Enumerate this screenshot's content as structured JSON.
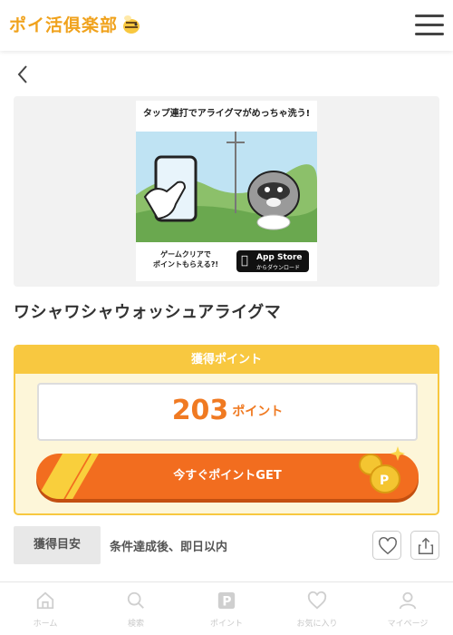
{
  "header": {
    "logo_text": "ポイ活俱楽部",
    "logo_icon": "bee-icon",
    "menu_icon": "hamburger-menu-icon"
  },
  "navigation": {
    "back_icon": "chevron-left-icon"
  },
  "banner": {
    "headline": "タップ連打でアライグマがめっちゃ洗う!",
    "cta_line1": "ゲームクリアで",
    "cta_line2": "ポイントもらえる?!",
    "store_name": "App Store",
    "store_sub": "からダウンロード"
  },
  "offer": {
    "title": "ワシャワシャウォッシュアライグマ",
    "panel_label": "獲得ポイント",
    "points": "203",
    "points_unit": "ポイント",
    "get_button_label": "今すぐポイントGET",
    "condition_label": "獲得目安",
    "condition_text": "条件達成後、即日以内"
  },
  "actions": {
    "favorite_icon": "heart-icon",
    "share_icon": "share-icon"
  },
  "bottom_nav": {
    "items": [
      {
        "label": "ホーム",
        "icon": "home-icon"
      },
      {
        "label": "検索",
        "icon": "search-icon"
      },
      {
        "label": "ポイント",
        "icon": "point-icon"
      },
      {
        "label": "お気に入り",
        "icon": "heart-icon"
      },
      {
        "label": "マイページ",
        "icon": "user-icon"
      }
    ]
  },
  "colors": {
    "accent_orange": "#f26d1f",
    "accent_yellow": "#f8c840",
    "points_text": "#f07a22",
    "logo": "#f0a21c"
  }
}
